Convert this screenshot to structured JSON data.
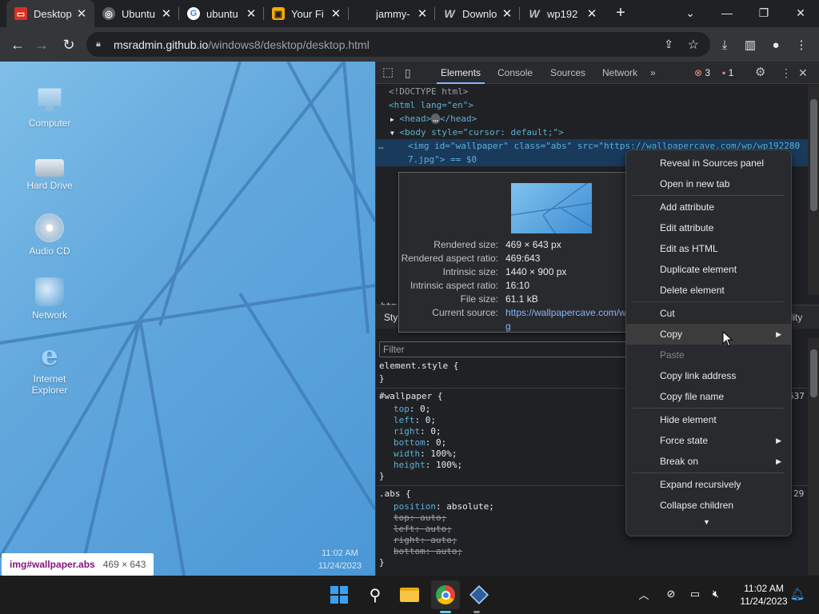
{
  "browser": {
    "tabs": [
      {
        "title": "Desktop",
        "icon": "desktop-favicon",
        "active": true
      },
      {
        "title": "Ubuntu",
        "icon": "ubuntu-favicon"
      },
      {
        "title": "ubuntu",
        "icon": "google-favicon"
      },
      {
        "title": "Your Fi",
        "icon": "yourfi-favicon"
      },
      {
        "title": "jammy-",
        "icon": "none"
      },
      {
        "title": "Downlo",
        "icon": "w-favicon"
      },
      {
        "title": "wp192",
        "icon": "w-favicon"
      }
    ],
    "address": {
      "host": "msradmin.github.io",
      "path": "/windows8/desktop/desktop.html"
    }
  },
  "desktop": {
    "icons": [
      {
        "label": "Computer"
      },
      {
        "label": "Hard Drive"
      },
      {
        "label": "Audio CD"
      },
      {
        "label": "Network"
      },
      {
        "label": "Internet Explorer"
      }
    ],
    "time": "11:02 AM",
    "date": "11/24/2023",
    "tooltip": {
      "selector": "img#wallpaper.abs",
      "dimensions": "469 × 643"
    }
  },
  "devtools": {
    "tabs": [
      "Elements",
      "Console",
      "Sources",
      "Network"
    ],
    "errors": "3",
    "issues": "1",
    "dom": {
      "doctype": "<!DOCTYPE html>",
      "html_open": "<html lang=\"en\">",
      "head": "<head>",
      "head_close": "</head>",
      "body_open": "<body style=\"cursor: default;\">",
      "img_line1": "<img id=\"wallpaper\" class=\"abs\" src=\"https://wallpapercave.com/wp/wp192280",
      "img_line2": "7.jpg\"> == $0",
      "bottom_crumb": "htm"
    },
    "styles_tab": "Styl",
    "filter_placeholder": "Filter",
    "rules": [
      {
        "selector": "element.style {",
        "close": "}"
      },
      {
        "selector": "#wallpaper {",
        "source": "537",
        "props": [
          [
            "top",
            "0;"
          ],
          [
            "left",
            "0;"
          ],
          [
            "right",
            "0;"
          ],
          [
            "bottom",
            "0;"
          ],
          [
            "width",
            "100%;"
          ],
          [
            "height",
            "100%;"
          ]
        ],
        "close": "}"
      },
      {
        "selector": ".abs {",
        "source": "29",
        "props": [
          [
            "position",
            "absolute;"
          ]
        ],
        "struck": [
          [
            "top",
            "auto;"
          ],
          [
            "left",
            "auto;"
          ],
          [
            "right",
            "auto;"
          ],
          [
            "bottom",
            "auto;"
          ]
        ],
        "close": "}"
      }
    ],
    "popover": {
      "rendered_size_k": "Rendered size:",
      "rendered_size_v": "469 × 643 px",
      "aspect_k": "Rendered aspect ratio:",
      "aspect_v": "469:643",
      "intrinsic_k": "Intrinsic size:",
      "intrinsic_v": "1440 × 900 px",
      "intrinsic_aspect_k": "Intrinsic aspect ratio:",
      "intrinsic_aspect_v": "16:10",
      "filesize_k": "File size:",
      "filesize_v": "61.1 kB",
      "source_k": "Current source:",
      "source_v1": "https://wallpapercave.com/w",
      "source_v2": "g"
    },
    "side_label": "ility"
  },
  "context_menu": [
    {
      "label": "Reveal in Sources panel"
    },
    {
      "label": "Open in new tab"
    },
    {
      "label": "Add attribute"
    },
    {
      "label": "Edit attribute"
    },
    {
      "label": "Edit as HTML"
    },
    {
      "label": "Duplicate element"
    },
    {
      "label": "Delete element"
    },
    {
      "label": "Cut"
    },
    {
      "label": "Copy"
    },
    {
      "label": "Paste"
    },
    {
      "label": "Copy link address"
    },
    {
      "label": "Copy file name"
    },
    {
      "label": "Hide element"
    },
    {
      "label": "Force state"
    },
    {
      "label": "Break on"
    },
    {
      "label": "Expand recursively"
    },
    {
      "label": "Collapse children"
    }
  ],
  "taskbar": {
    "time": "11:02 AM",
    "date": "11/24/2023",
    "apps": [
      "start-icon",
      "search-icon",
      "file-explorer-icon",
      "chrome-icon",
      "virtualbox-icon"
    ]
  }
}
